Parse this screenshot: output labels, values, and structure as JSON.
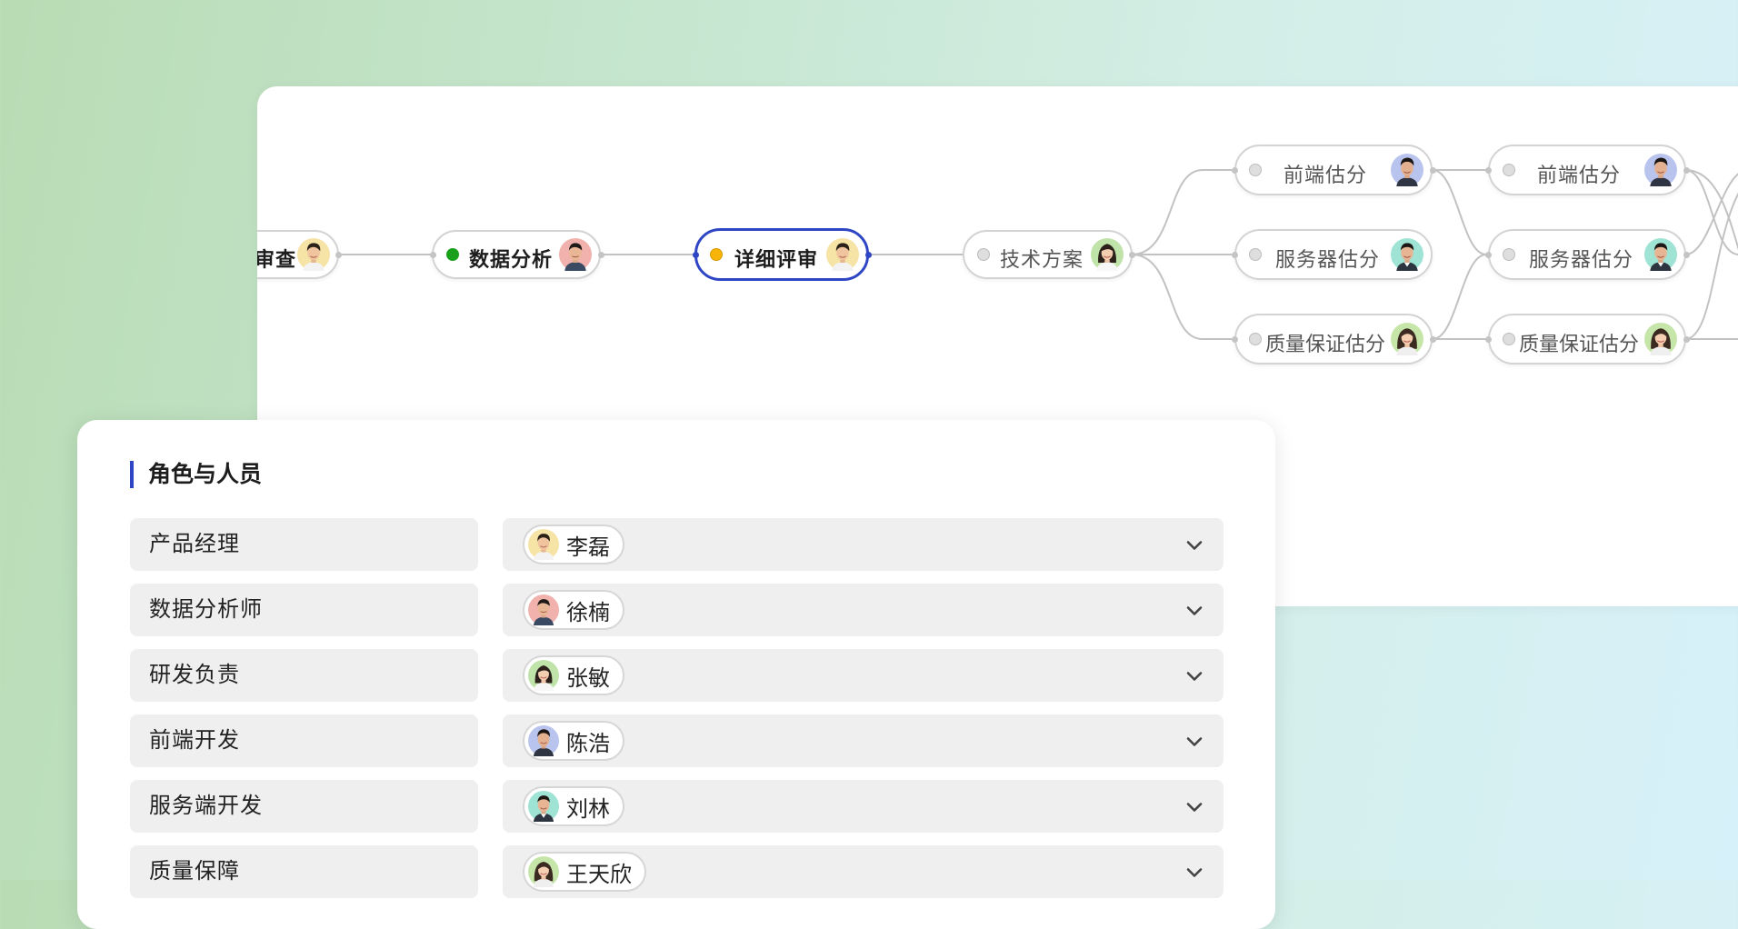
{
  "flow": {
    "stages": [
      {
        "label": "审查",
        "style": "dark",
        "dot": "none",
        "avatar": "avatar-man-smile"
      },
      {
        "label": "数据分析",
        "style": "dark",
        "dot": "green",
        "avatar": "avatar-man-pink"
      },
      {
        "label": "详细评审",
        "style": "dark-active",
        "dot": "yellow",
        "avatar": "avatar-man-smile"
      },
      {
        "label": "技术方案",
        "style": "light",
        "dot": "gray",
        "avatar": "avatar-woman"
      },
      {
        "label": "前端估分",
        "style": "light",
        "dot": "gray",
        "avatar": "avatar-man-blue"
      },
      {
        "label": "服务器估分",
        "style": "light",
        "dot": "gray",
        "avatar": "avatar-man-teal"
      },
      {
        "label": "质量保证估分",
        "style": "light",
        "dot": "gray",
        "avatar": "avatar-woman-2"
      },
      {
        "label": "前端估分",
        "style": "light",
        "dot": "gray",
        "avatar": "avatar-man-blue"
      },
      {
        "label": "服务器估分",
        "style": "light",
        "dot": "gray",
        "avatar": "avatar-man-teal"
      },
      {
        "label": "质量保证估分",
        "style": "light",
        "dot": "gray",
        "avatar": "avatar-woman-2"
      }
    ],
    "colors": {
      "active_border": "#2e46c4",
      "done_dot": "#1ba01b",
      "current_dot": "#f7b50a",
      "pending_dot": "#dedede"
    }
  },
  "roles": {
    "title": "角色与人员",
    "rows": [
      {
        "role": "产品经理",
        "person": "李磊",
        "avatar": "avatar-man-smile"
      },
      {
        "role": "数据分析师",
        "person": "徐楠",
        "avatar": "avatar-man-pink"
      },
      {
        "role": "研发负责",
        "person": "张敏",
        "avatar": "avatar-woman"
      },
      {
        "role": "前端开发",
        "person": "陈浩",
        "avatar": "avatar-man-blue"
      },
      {
        "role": "服务端开发",
        "person": "刘林",
        "avatar": "avatar-man-teal"
      },
      {
        "role": "质量保障",
        "person": "王天欣",
        "avatar": "avatar-woman-2"
      }
    ],
    "dropdown_icon": "chevron-down-icon"
  }
}
